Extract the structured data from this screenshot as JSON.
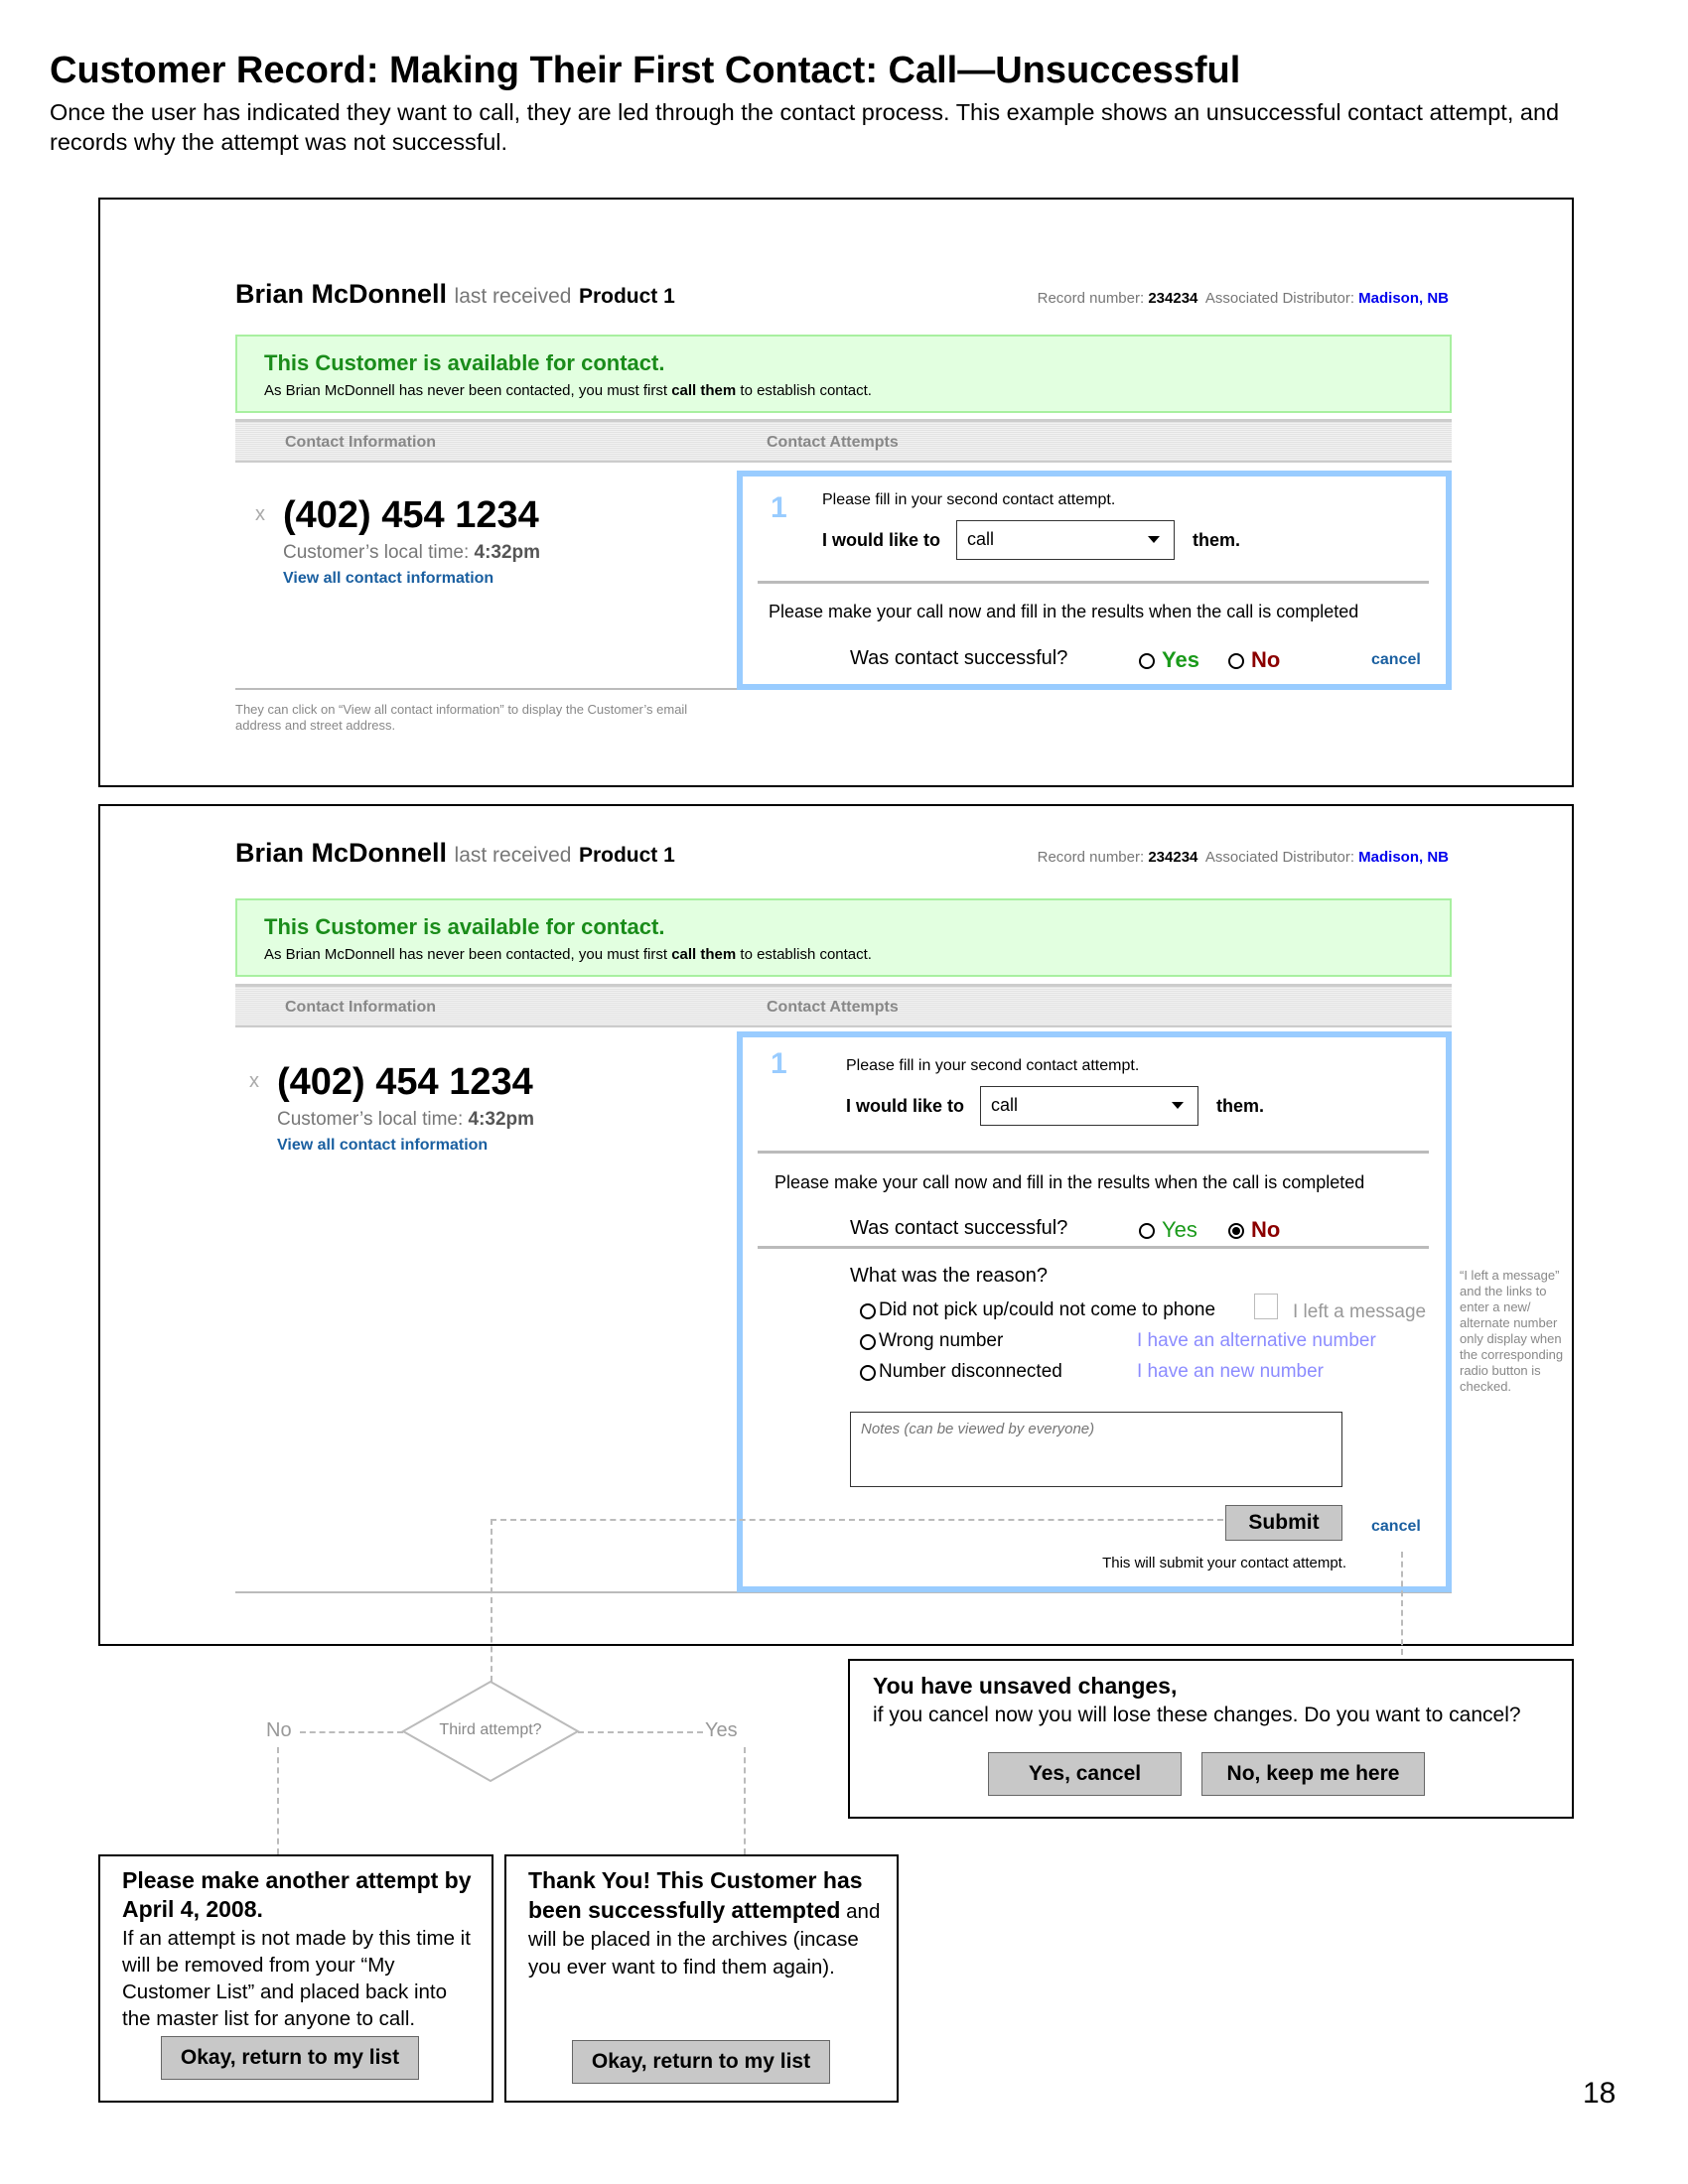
{
  "page": {
    "title": "Customer Record: Making Their First Contact: Call—Unsuccessful",
    "description": "Once the user has indicated they want to call, they are led through the contact process. This example shows an unsuccessful contact attempt, and records why the attempt was not successful.",
    "page_number": "18"
  },
  "record": {
    "customer_name": "Brian McDonnell",
    "last_received_label": "last received",
    "product": "Product 1",
    "record_number_label": "Record number:",
    "record_number": "234234",
    "distributor_label": "Associated Distributor:",
    "distributor": "Madison, NB",
    "banner_title": "This Customer is available for contact.",
    "banner_pre": "As Brian McDonnell has never been contacted, you must first ",
    "banner_bold": "call them",
    "banner_post": " to establish contact.",
    "tab_contact_info": "Contact Information",
    "tab_contact_attempts": "Contact Attempts",
    "phone": "(402) 454 1234",
    "local_time_label": "Customer’s local time:",
    "local_time": "4:32pm",
    "view_all_link": "View all contact information",
    "remove_icon": "x"
  },
  "attempt": {
    "step_number": "1",
    "instruction": "Please fill in your second contact attempt.",
    "would_like_label": "I would like to",
    "method_selected": "call",
    "them_label": "them.",
    "call_now_text": "Please make your call now and fill in the results when the call is completed",
    "success_question": "Was contact successful?",
    "yes_label": "Yes",
    "no_label": "No",
    "cancel_label": "cancel"
  },
  "panel1": {
    "selected_answer": "none",
    "annotation": "They can click on “View all contact information” to display the Customer’s email address and street address."
  },
  "panel2": {
    "selected_answer": "No",
    "reason_question": "What was the reason?",
    "reasons": [
      "Did not pick up/could not come to phone",
      "Wrong number",
      "Number disconnected"
    ],
    "left_message_label": "I left a message",
    "alt_number_link": "I have an alternative number",
    "new_number_link": "I have an new number",
    "notes_placeholder": "Notes (can be viewed by everyone)",
    "submit_label": "Submit",
    "submit_hint": "This will submit your contact attempt.",
    "side_annotation": "“I left a message” and the links to enter a new/ alternate number only display when the corresponding radio button is checked."
  },
  "flow": {
    "decision": "Third attempt?",
    "no_label": "No",
    "yes_label": "Yes"
  },
  "unsaved_dialog": {
    "title": "You have unsaved changes,",
    "message": "if you cancel now you will lose these changes. Do you want to cancel?",
    "yes_button": "Yes, cancel",
    "no_button": "No, keep me here"
  },
  "another_attempt_dialog": {
    "title": "Please make another attempt by April 4, 2008.",
    "message": "If an attempt is not made by this time it will be removed from your “My Customer List” and placed back into the master list for anyone to call.",
    "button": "Okay, return to my list"
  },
  "thank_you_dialog": {
    "title": "Thank You! This Customer has been successfully attempted",
    "message": " and will be placed in the archives (incase you ever want to find them again).",
    "button": "Okay, return to my list"
  },
  "colors": {
    "accent_blue": "#99ccff",
    "banner_green": "#e2ffe0",
    "yes_green": "#1a9a1a",
    "no_red": "#8b0000",
    "link_blue": "#1a5fa0"
  }
}
